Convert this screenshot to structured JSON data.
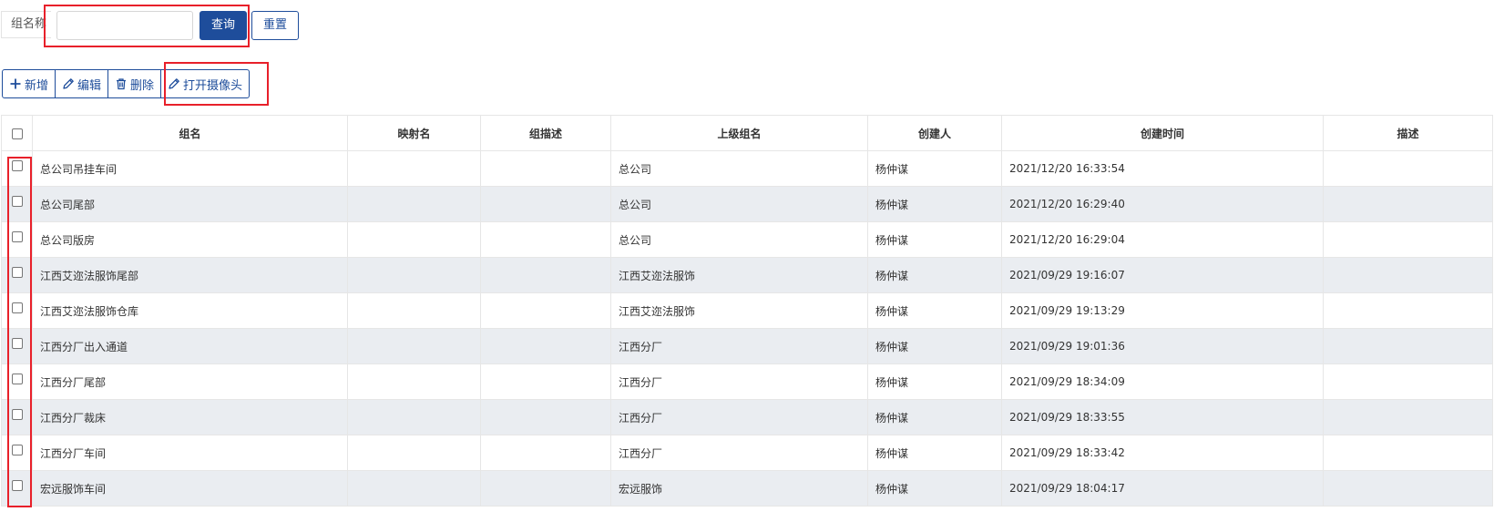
{
  "search": {
    "label": "组名称",
    "value": "",
    "placeholder": "",
    "query_label": "查询",
    "reset_label": "重置"
  },
  "toolbar": {
    "add_label": "新增",
    "edit_label": "编辑",
    "delete_label": "删除",
    "camera_label": "打开摄像头"
  },
  "table": {
    "headers": [
      "组名",
      "映射名",
      "组描述",
      "上级组名",
      "创建人",
      "创建时间",
      "描述"
    ],
    "rows": [
      [
        "总公司吊挂车间",
        "",
        "",
        "总公司",
        "杨仲谋",
        "2021/12/20 16:33:54",
        ""
      ],
      [
        "总公司尾部",
        "",
        "",
        "总公司",
        "杨仲谋",
        "2021/12/20 16:29:40",
        ""
      ],
      [
        "总公司版房",
        "",
        "",
        "总公司",
        "杨仲谋",
        "2021/12/20 16:29:04",
        ""
      ],
      [
        "江西艾迩法服饰尾部",
        "",
        "",
        "江西艾迩法服饰",
        "杨仲谋",
        "2021/09/29 19:16:07",
        ""
      ],
      [
        "江西艾迩法服饰仓库",
        "",
        "",
        "江西艾迩法服饰",
        "杨仲谋",
        "2021/09/29 19:13:29",
        ""
      ],
      [
        "江西分厂出入通道",
        "",
        "",
        "江西分厂",
        "杨仲谋",
        "2021/09/29 19:01:36",
        ""
      ],
      [
        "江西分厂尾部",
        "",
        "",
        "江西分厂",
        "杨仲谋",
        "2021/09/29 18:34:09",
        ""
      ],
      [
        "江西分厂裁床",
        "",
        "",
        "江西分厂",
        "杨仲谋",
        "2021/09/29 18:33:55",
        ""
      ],
      [
        "江西分厂车间",
        "",
        "",
        "江西分厂",
        "杨仲谋",
        "2021/09/29 18:33:42",
        ""
      ],
      [
        "宏远服饰车间",
        "",
        "",
        "宏远服饰",
        "杨仲谋",
        "2021/09/29 18:04:17",
        ""
      ]
    ]
  },
  "colors": {
    "primary": "#1e4d9b",
    "highlight": "#e8202a",
    "row_alt": "#eaedf1"
  }
}
